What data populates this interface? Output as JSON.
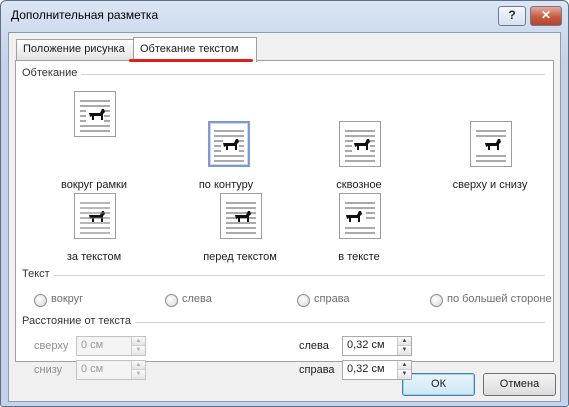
{
  "window": {
    "title": "Дополнительная разметка",
    "help_label": "?",
    "close_label": "✕"
  },
  "tabs": [
    {
      "label": "Положение рисунка",
      "active": false
    },
    {
      "label": "Обтекание текстом",
      "active": true
    }
  ],
  "wrapping": {
    "group_label": "Обтекание",
    "options": [
      {
        "label": "вокруг рамки",
        "icon": "wrap-square-icon",
        "selected": false
      },
      {
        "label": "по контуру",
        "icon": "wrap-tight-icon",
        "selected": true
      },
      {
        "label": "сквозное",
        "icon": "wrap-through-icon",
        "selected": false
      },
      {
        "label": "сверху и снизу",
        "icon": "wrap-top-bottom-icon",
        "selected": false
      },
      {
        "label": "за текстом",
        "icon": "wrap-behind-text-icon",
        "selected": false
      },
      {
        "label": "перед текстом",
        "icon": "wrap-in-front-icon",
        "selected": false
      },
      {
        "label": "в тексте",
        "icon": "wrap-inline-icon",
        "selected": false
      }
    ]
  },
  "text_wrap": {
    "group_label": "Текст",
    "options": [
      {
        "label": "вокруг"
      },
      {
        "label": "слева"
      },
      {
        "label": "справа"
      },
      {
        "label": "по большей стороне"
      }
    ]
  },
  "distance": {
    "group_label": "Расстояние от текста",
    "top": {
      "label": "сверху",
      "value": "0 см",
      "enabled": false
    },
    "bottom": {
      "label": "снизу",
      "value": "0 см",
      "enabled": false
    },
    "left": {
      "label": "слева",
      "value": "0,32 см",
      "enabled": true
    },
    "right": {
      "label": "справа",
      "value": "0,32 см",
      "enabled": true
    }
  },
  "buttons": {
    "ok": "ОК",
    "cancel": "Отмена"
  },
  "colors": {
    "accent_underline": "#e21d1d",
    "selection_border": "#7a9cd0"
  }
}
